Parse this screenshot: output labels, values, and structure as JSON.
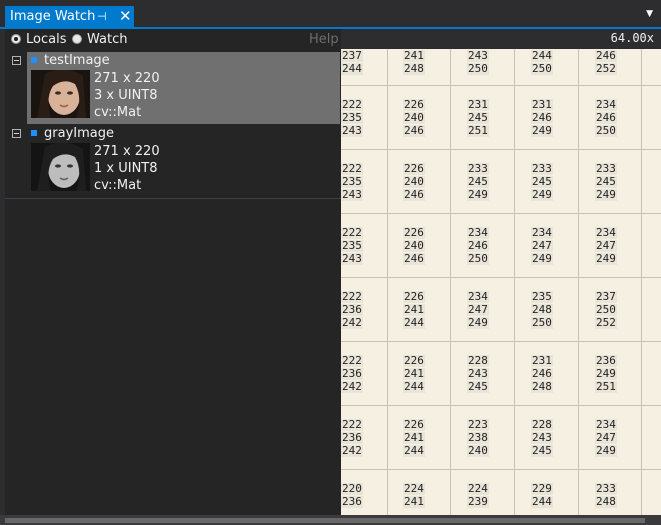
{
  "window": {
    "tab_title": "Image Watch",
    "pin_glyph": "⊣",
    "close_glyph": "✕",
    "dropdown_glyph": "▼"
  },
  "toolbar": {
    "locals_label": "Locals",
    "watch_label": "Watch",
    "help_label": "Help",
    "selected": "Locals"
  },
  "images": [
    {
      "name": "testImage",
      "size": "271 x 220",
      "format": "3 x UINT8",
      "type": "cv::Mat",
      "selected": true
    },
    {
      "name": "grayImage",
      "size": "271 x 220",
      "format": "1 x UINT8",
      "type": "cv::Mat",
      "selected": false
    }
  ],
  "viewer": {
    "zoom": "64.00x",
    "grid": [
      [
        [
          "237",
          "244"
        ],
        [
          "241",
          "248"
        ],
        [
          "243",
          "250"
        ],
        [
          "244",
          "250"
        ],
        [
          "246",
          "252"
        ]
      ],
      [
        [
          "222",
          "235",
          "243"
        ],
        [
          "226",
          "240",
          "246"
        ],
        [
          "231",
          "245",
          "251"
        ],
        [
          "231",
          "246",
          "249"
        ],
        [
          "234",
          "246",
          "250"
        ]
      ],
      [
        [
          "222",
          "235",
          "243"
        ],
        [
          "226",
          "240",
          "246"
        ],
        [
          "233",
          "245",
          "249"
        ],
        [
          "233",
          "245",
          "249"
        ],
        [
          "233",
          "245",
          "249"
        ]
      ],
      [
        [
          "222",
          "235",
          "243"
        ],
        [
          "226",
          "240",
          "246"
        ],
        [
          "234",
          "246",
          "250"
        ],
        [
          "234",
          "247",
          "249"
        ],
        [
          "234",
          "247",
          "249"
        ]
      ],
      [
        [
          "222",
          "236",
          "242"
        ],
        [
          "226",
          "241",
          "244"
        ],
        [
          "234",
          "247",
          "249"
        ],
        [
          "235",
          "248",
          "250"
        ],
        [
          "237",
          "250",
          "252"
        ]
      ],
      [
        [
          "222",
          "236",
          "242"
        ],
        [
          "226",
          "241",
          "244"
        ],
        [
          "228",
          "243",
          "245"
        ],
        [
          "231",
          "246",
          "248"
        ],
        [
          "236",
          "249",
          "251"
        ]
      ],
      [
        [
          "222",
          "236",
          "242"
        ],
        [
          "226",
          "241",
          "244"
        ],
        [
          "223",
          "238",
          "240"
        ],
        [
          "228",
          "243",
          "245"
        ],
        [
          "234",
          "247",
          "249"
        ]
      ],
      [
        [
          "220",
          "236"
        ],
        [
          "224",
          "241"
        ],
        [
          "224",
          "239"
        ],
        [
          "229",
          "244"
        ],
        [
          "233",
          "248"
        ]
      ]
    ]
  }
}
